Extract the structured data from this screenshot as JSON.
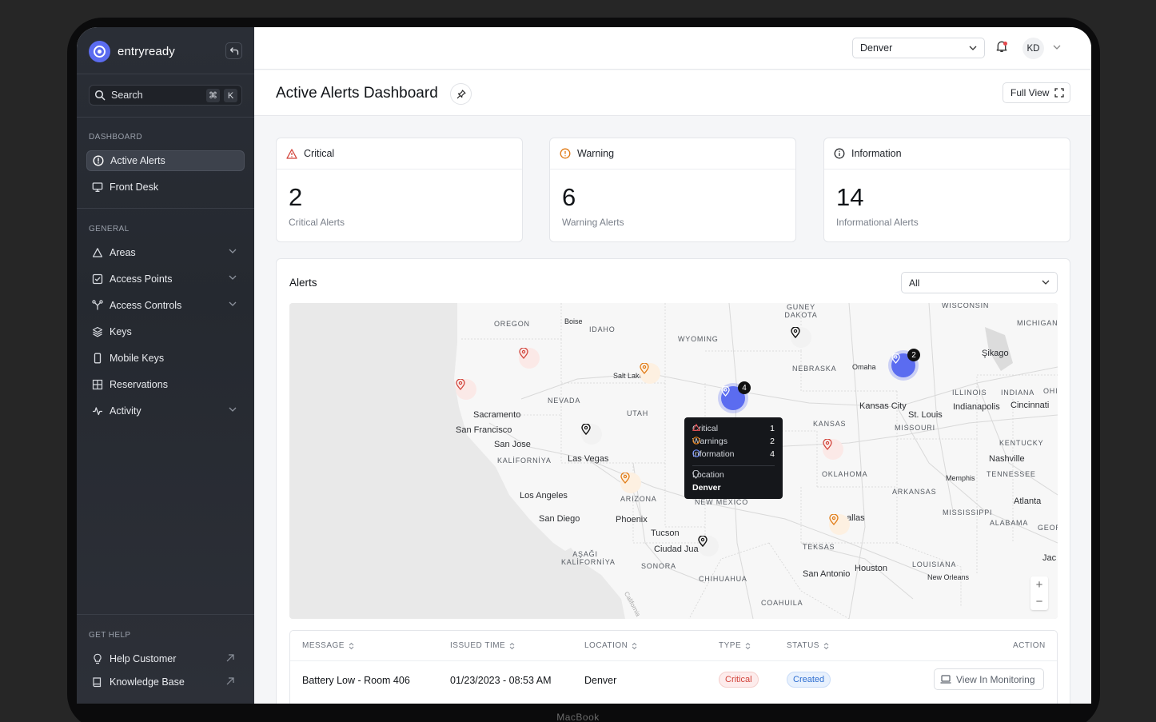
{
  "device_label": "MacBook",
  "brand": {
    "name": "entryready"
  },
  "search": {
    "label": "Search",
    "shortcut_key1": "⌘",
    "shortcut_key2": "K"
  },
  "sidebar": {
    "sections": [
      {
        "label": "DASHBOARD",
        "items": [
          {
            "label": "Active Alerts",
            "icon": "alert-circle-icon",
            "active": true
          },
          {
            "label": "Front Desk",
            "icon": "monitor-icon"
          }
        ]
      },
      {
        "label": "GENERAL",
        "items": [
          {
            "label": "Areas",
            "icon": "triangle-icon",
            "expandable": true
          },
          {
            "label": "Access Points",
            "icon": "checkbox-icon",
            "expandable": true
          },
          {
            "label": "Access Controls",
            "icon": "network-icon",
            "expandable": true
          },
          {
            "label": "Keys",
            "icon": "layers-icon"
          },
          {
            "label": "Mobile Keys",
            "icon": "phone-icon"
          },
          {
            "label": "Reservations",
            "icon": "grid-icon"
          },
          {
            "label": "Activity",
            "icon": "pulse-icon",
            "expandable": true
          }
        ]
      },
      {
        "label": "GET HELP",
        "items": [
          {
            "label": "Help Customer",
            "icon": "lightbulb-icon"
          },
          {
            "label": "Knowledge Base",
            "icon": "book-icon"
          }
        ]
      }
    ]
  },
  "topbar": {
    "location": "Denver",
    "user_initials": "KD"
  },
  "page": {
    "title": "Active Alerts Dashboard",
    "full_view_label": "Full View"
  },
  "stats": [
    {
      "title": "Critical",
      "value": "2",
      "subtitle": "Critical Alerts",
      "color": "#d2443b"
    },
    {
      "title": "Warning",
      "value": "6",
      "subtitle": "Warning Alerts",
      "color": "#e07a14"
    },
    {
      "title": "Information",
      "value": "14",
      "subtitle": "Informational Alerts",
      "color": "#2d2f33"
    }
  ],
  "alerts": {
    "title": "Alerts",
    "filter": "All",
    "map": {
      "cluster_denver_count": "4",
      "cluster_iowa_count": "2",
      "tooltip": {
        "critical_label": "Critical",
        "critical_value": "1",
        "warnings_label": "Warnings",
        "warnings_value": "2",
        "information_label": "Information",
        "information_value": "4",
        "location_label": "Location",
        "location_value": "Denver"
      },
      "labels": {
        "oregon": "OREGON",
        "boise": "Boise",
        "idaho": "IDAHO",
        "wyoming": "WYOMING",
        "guney_dakota": "GUNEY DAKOTA",
        "wisconsin": "WISCONSIN",
        "michigan": "MICHIGAN",
        "sikago": "Şikago",
        "nebraska": "NEBRASKA",
        "omaha": "Omaha",
        "salt_lake": "Salt Lake",
        "nevada": "NEVADA",
        "utah": "UTAH",
        "sacramento": "Sacramento",
        "san_francisco": "San Francisco",
        "san_jose": "San Jose",
        "kaliforniya": "KALİFORNİYA",
        "las_vegas": "Las Vegas",
        "kansas": "KANSAS",
        "kansas_city": "Kansas City",
        "st_louis": "St. Louis",
        "missouri": "MISSOURI",
        "illinois": "ILLINOIS",
        "indiana": "INDIANA",
        "ohio": "OHI",
        "indianapolis": "Indianapolis",
        "cincinnati": "Cincinnati",
        "kentucky": "KENTUCKY",
        "nashville": "Nashville",
        "tennessee": "TENNESSEE",
        "memphis": "Memphis",
        "oklahoma": "OKLAHOMA",
        "arkansas": "ARKANSAS",
        "los_angeles": "Los Angeles",
        "arizona": "ARIZONA",
        "new_mexico": "NEW MEXICO",
        "san_diego": "San Diego",
        "phoenix": "Phoenix",
        "tucson": "Tucson",
        "ciudad": "Ciudad Jua",
        "asagi": "AŞAĞI KALİFORNİYA",
        "sonora": "SONORA",
        "chihuahua": "CHIHUAHUA",
        "coahuila": "COAHUILA",
        "teksas": "TEKSAS",
        "dallas": "allas",
        "san_antonio": "San Antonio",
        "houston": "Houston",
        "louisiana": "LOUISIANA",
        "new_orleans": "New Orleans",
        "mississippi": "MISSISSIPPI",
        "alabama": "ALABAMA",
        "atlanta": "Atlanta",
        "georgia": "GEORGİ",
        "jac": "Jac",
        "gulf": "California"
      }
    },
    "table": {
      "columns": [
        "MESSAGE",
        "ISSUED TIME",
        "LOCATION",
        "TYPE",
        "STATUS",
        "ACTION"
      ],
      "rows": [
        {
          "message": "Battery Low - Room 406",
          "issued_time": "01/23/2023 - 08:53 AM",
          "location": "Denver",
          "type": "Critical",
          "status": "Created",
          "action": "View In Monitoring"
        }
      ]
    }
  }
}
